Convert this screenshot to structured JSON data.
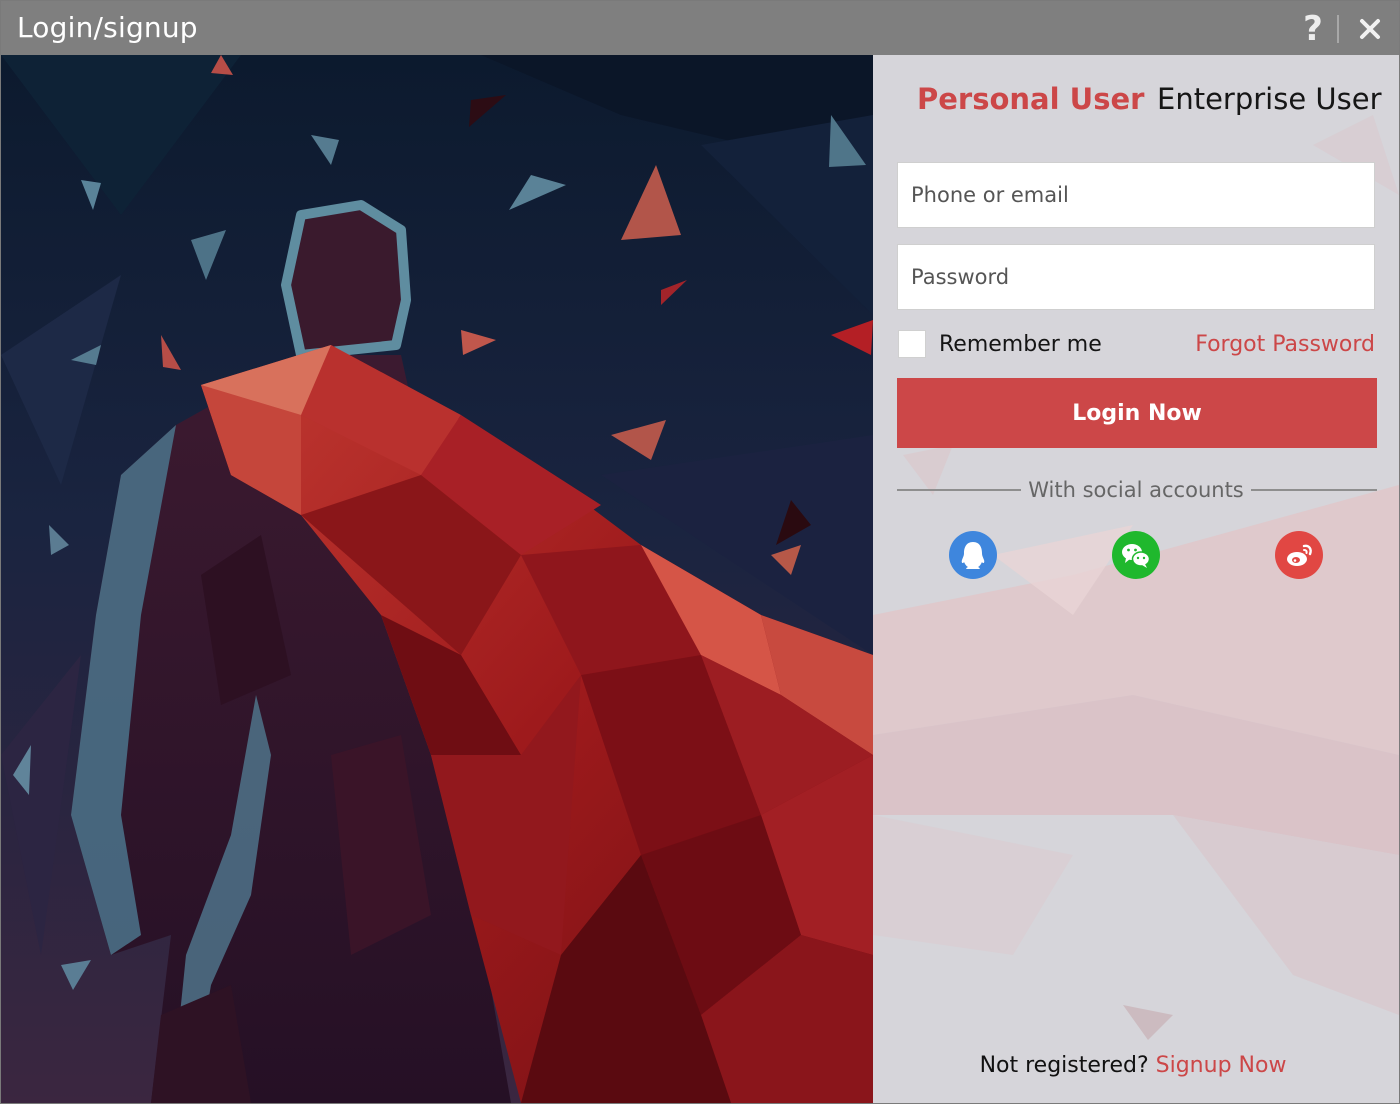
{
  "window": {
    "title": "Login/signup",
    "help_label": "?"
  },
  "tabs": {
    "personal": "Personal User",
    "enterprise": "Enterprise User"
  },
  "form": {
    "phone_placeholder": "Phone or email",
    "password_placeholder": "Password",
    "remember_label": "Remember me",
    "forgot_label": "Forgot Password",
    "login_label": "Login Now"
  },
  "social": {
    "label": "With social accounts",
    "icons": [
      "qq-icon",
      "wechat-icon",
      "weibo-icon"
    ]
  },
  "footer": {
    "question": "Not registered?",
    "signup_label": "Signup Now"
  },
  "colors": {
    "accent": "#cc4748",
    "titlebar": "#7f7f7f",
    "qq": "#3e86dd",
    "wechat": "#1fb82d",
    "weibo": "#e14743"
  }
}
